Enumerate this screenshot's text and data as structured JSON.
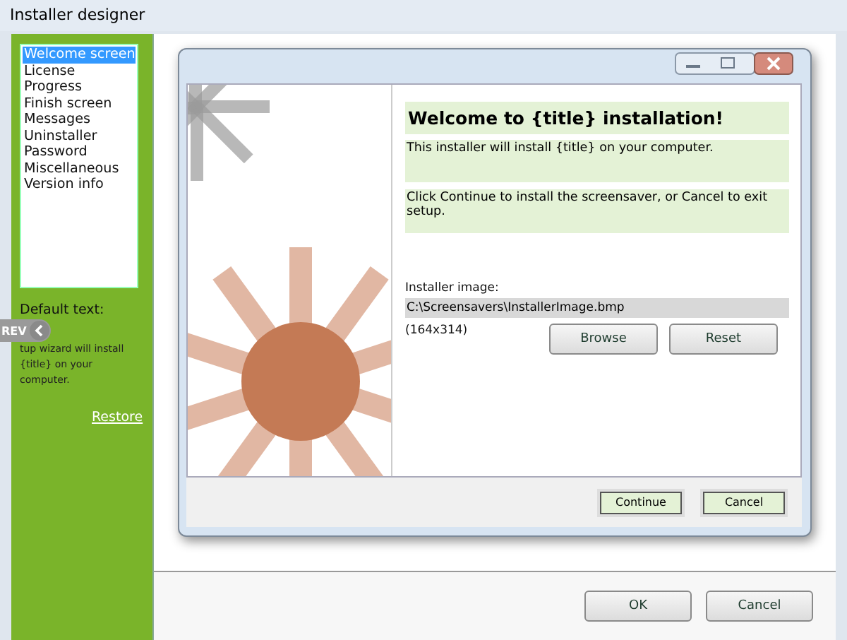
{
  "window": {
    "title": "Installer designer"
  },
  "sidebar": {
    "items": [
      {
        "label": "Welcome screen",
        "selected": true
      },
      {
        "label": "License",
        "selected": false
      },
      {
        "label": "Progress",
        "selected": false
      },
      {
        "label": "Finish screen",
        "selected": false
      },
      {
        "label": "Messages",
        "selected": false
      },
      {
        "label": "Uninstaller",
        "selected": false
      },
      {
        "label": "Password",
        "selected": false
      },
      {
        "label": "Miscellaneous",
        "selected": false
      },
      {
        "label": "Version info",
        "selected": false
      }
    ],
    "default_text_label": "Default text:",
    "default_text": "tup wizard will install {title} on your computer.",
    "restore_link": "Restore",
    "rev_tab": "REV"
  },
  "preview": {
    "heading": "Welcome to {title} installation!",
    "intro": "This installer will install {title} on your computer.",
    "instructions": "Click Continue to install the screensaver, or Cancel to exit setup.",
    "image_label": "Installer image:",
    "image_path": "C:\\Screensavers\\InstallerImage.bmp",
    "image_size": "(164x314)",
    "buttons": [
      "Browse",
      "Reset"
    ],
    "dialog_buttons": [
      "Continue",
      "Cancel"
    ]
  },
  "buttons": [
    "OK",
    "Cancel"
  ]
}
